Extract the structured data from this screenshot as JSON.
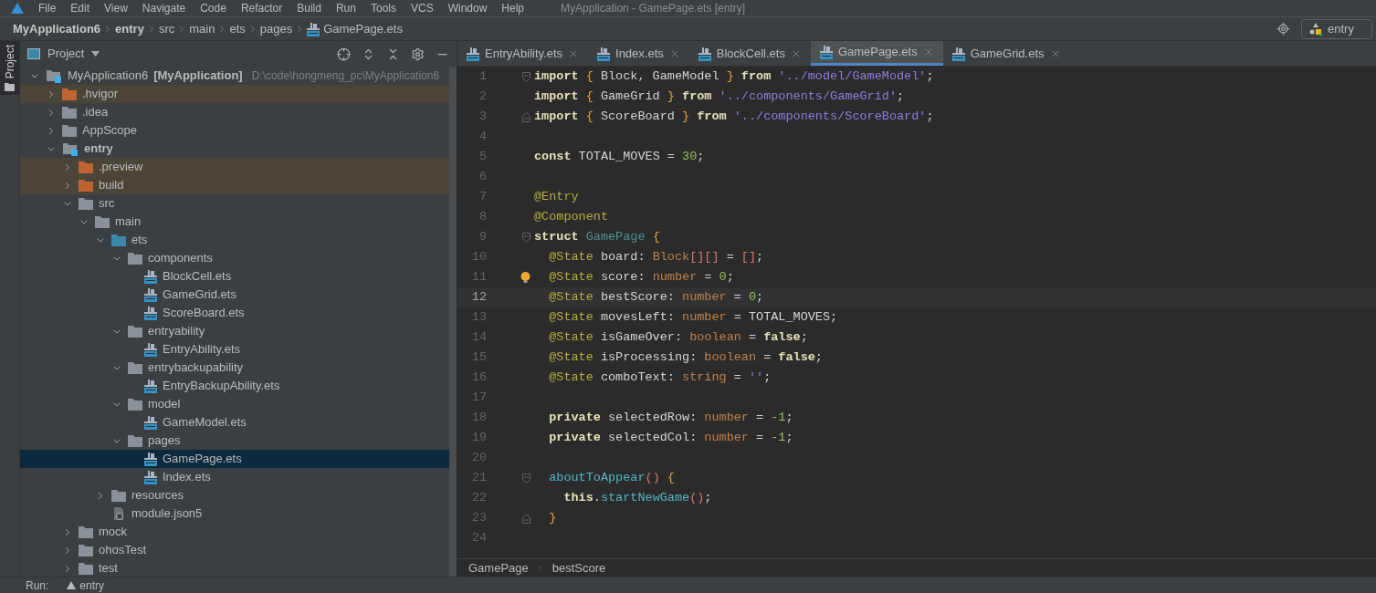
{
  "menu": {
    "items": [
      "File",
      "Edit",
      "View",
      "Navigate",
      "Code",
      "Refactor",
      "Build",
      "Run",
      "Tools",
      "VCS",
      "Window",
      "Help"
    ],
    "title": "MyApplication - GamePage.ets [entry]"
  },
  "nav_bar": {
    "crumbs": [
      {
        "label": "MyApplication6",
        "bold": true,
        "kind": "plain"
      },
      {
        "label": "entry",
        "bold": true,
        "kind": "plain"
      },
      {
        "label": "src",
        "bold": false,
        "kind": "plain"
      },
      {
        "label": "main",
        "bold": false,
        "kind": "plain"
      },
      {
        "label": "ets",
        "bold": false,
        "kind": "plain"
      },
      {
        "label": "pages",
        "bold": false,
        "kind": "plain"
      },
      {
        "label": "GamePage.ets",
        "bold": false,
        "kind": "ets"
      }
    ],
    "run_config": "entry"
  },
  "side_strip": {
    "tab": "Project"
  },
  "project_panel": {
    "title": "Project",
    "root": {
      "name": "MyApplication6",
      "module": "[MyApplication]",
      "path": "D:\\code\\hongmeng_pc\\MyApplication6",
      "expanded": true
    },
    "tree": [
      {
        "name": ".hvigor",
        "kind": "excluded",
        "expanded": false,
        "selected": false
      },
      {
        "name": ".idea",
        "kind": "folder",
        "expanded": false,
        "selected": false
      },
      {
        "name": "AppScope",
        "kind": "folder",
        "expanded": false,
        "selected": false
      },
      {
        "name": "entry",
        "kind": "module",
        "expanded": true,
        "selected": false,
        "children": [
          {
            "name": ".preview",
            "kind": "excluded",
            "expanded": false,
            "selected": false
          },
          {
            "name": "build",
            "kind": "excluded",
            "expanded": false,
            "selected": false
          },
          {
            "name": "src",
            "kind": "folder",
            "expanded": true,
            "selected": false,
            "children": [
              {
                "name": "main",
                "kind": "folder",
                "expanded": true,
                "selected": false,
                "children": [
                  {
                    "name": "ets",
                    "kind": "source",
                    "expanded": true,
                    "selected": false,
                    "children": [
                      {
                        "name": "components",
                        "kind": "folder",
                        "expanded": true,
                        "selected": false,
                        "children": [
                          {
                            "name": "BlockCell.ets",
                            "kind": "ets",
                            "selected": false
                          },
                          {
                            "name": "GameGrid.ets",
                            "kind": "ets",
                            "selected": false
                          },
                          {
                            "name": "ScoreBoard.ets",
                            "kind": "ets",
                            "selected": false
                          }
                        ]
                      },
                      {
                        "name": "entryability",
                        "kind": "folder",
                        "expanded": true,
                        "selected": false,
                        "children": [
                          {
                            "name": "EntryAbility.ets",
                            "kind": "ets",
                            "selected": false
                          }
                        ]
                      },
                      {
                        "name": "entrybackupability",
                        "kind": "folder",
                        "expanded": true,
                        "selected": false,
                        "children": [
                          {
                            "name": "EntryBackupAbility.ets",
                            "kind": "ets",
                            "selected": false
                          }
                        ]
                      },
                      {
                        "name": "model",
                        "kind": "folder",
                        "expanded": true,
                        "selected": false,
                        "children": [
                          {
                            "name": "GameModel.ets",
                            "kind": "ets",
                            "selected": false
                          }
                        ]
                      },
                      {
                        "name": "pages",
                        "kind": "folder",
                        "expanded": true,
                        "selected": false,
                        "children": [
                          {
                            "name": "GamePage.ets",
                            "kind": "ets",
                            "selected": true
                          },
                          {
                            "name": "Index.ets",
                            "kind": "ets",
                            "selected": false
                          }
                        ]
                      }
                    ]
                  },
                  {
                    "name": "resources",
                    "kind": "folder",
                    "expanded": false,
                    "selected": false
                  },
                  {
                    "name": "module.json5",
                    "kind": "json",
                    "selected": false
                  }
                ]
              }
            ]
          },
          {
            "name": "mock",
            "kind": "folder",
            "expanded": false,
            "selected": false
          },
          {
            "name": "ohosTest",
            "kind": "folder",
            "expanded": false,
            "selected": false
          },
          {
            "name": "test",
            "kind": "folder",
            "expanded": false,
            "selected": false
          }
        ]
      }
    ]
  },
  "tabs": [
    {
      "label": "EntryAbility.ets",
      "selected": false
    },
    {
      "label": "Index.ets",
      "selected": false
    },
    {
      "label": "BlockCell.ets",
      "selected": false
    },
    {
      "label": "GamePage.ets",
      "selected": true
    },
    {
      "label": "GameGrid.ets",
      "selected": false
    }
  ],
  "editor": {
    "lines": [
      {
        "number": "1",
        "current": false,
        "gutter": [
          {
            "kind": "fold_open"
          }
        ],
        "tokens": [
          {
            "kind": "kw",
            "text": "import"
          },
          {
            "kind": "br",
            "text": " {"
          },
          {
            "kind": "id",
            "text": " Block, GameModel"
          },
          {
            "kind": "br",
            "text": " }"
          },
          {
            "kind": "kw",
            "text": " from"
          },
          {
            "kind": "str",
            "text": " '../model/GameModel'"
          },
          {
            "kind": "id",
            "text": ";"
          }
        ]
      },
      {
        "number": "2",
        "current": false,
        "tokens": [
          {
            "kind": "kw",
            "text": "import"
          },
          {
            "kind": "br",
            "text": " {"
          },
          {
            "kind": "id",
            "text": " GameGrid"
          },
          {
            "kind": "br",
            "text": " }"
          },
          {
            "kind": "kw",
            "text": " from"
          },
          {
            "kind": "str",
            "text": " '../components/GameGrid'"
          },
          {
            "kind": "id",
            "text": ";"
          }
        ]
      },
      {
        "number": "3",
        "current": false,
        "gutter": [
          {
            "kind": "fold_close"
          }
        ],
        "tokens": [
          {
            "kind": "kw",
            "text": "import"
          },
          {
            "kind": "br",
            "text": " {"
          },
          {
            "kind": "id",
            "text": " ScoreBoard"
          },
          {
            "kind": "br",
            "text": " }"
          },
          {
            "kind": "kw",
            "text": " from"
          },
          {
            "kind": "str",
            "text": " '../components/ScoreBoard'"
          },
          {
            "kind": "id",
            "text": ";"
          }
        ]
      },
      {
        "number": "4",
        "current": false
      },
      {
        "number": "5",
        "current": false,
        "tokens": [
          {
            "kind": "kw",
            "text": "const"
          },
          {
            "kind": "id",
            "text": " TOTAL_MOVES ="
          },
          {
            "kind": "num",
            "text": " 30"
          },
          {
            "kind": "id",
            "text": ";"
          }
        ]
      },
      {
        "number": "6",
        "current": false
      },
      {
        "number": "7",
        "current": false,
        "tokens": [
          {
            "kind": "dec",
            "text": "@Entry"
          }
        ]
      },
      {
        "number": "8",
        "current": false,
        "tokens": [
          {
            "kind": "dec",
            "text": "@Component"
          }
        ]
      },
      {
        "number": "9",
        "current": false,
        "gutter": [
          {
            "kind": "fold_open"
          }
        ],
        "tokens": [
          {
            "kind": "kw",
            "text": "struct"
          },
          {
            "kind": "cls",
            "text": " GamePage"
          },
          {
            "kind": "br",
            "text": " {"
          }
        ]
      },
      {
        "number": "10",
        "current": false,
        "tokens": [
          {
            "kind": "dec",
            "text": "  @State"
          },
          {
            "kind": "id",
            "text": " board:"
          },
          {
            "kind": "type",
            "text": " Block"
          },
          {
            "kind": "paren",
            "text": "[][]"
          },
          {
            "kind": "id",
            "text": " ="
          },
          {
            "kind": "paren",
            "text": " []"
          },
          {
            "kind": "id",
            "text": ";"
          }
        ]
      },
      {
        "number": "11",
        "current": false,
        "gutter": [
          {
            "kind": "bulb"
          }
        ],
        "tokens": [
          {
            "kind": "dec",
            "text": "  @State"
          },
          {
            "kind": "id",
            "text": " score:"
          },
          {
            "kind": "type",
            "text": " number"
          },
          {
            "kind": "id",
            "text": " ="
          },
          {
            "kind": "num",
            "text": " 0"
          },
          {
            "kind": "id",
            "text": ";"
          }
        ]
      },
      {
        "number": "12",
        "current": true,
        "tokens": [
          {
            "kind": "dec",
            "text": "  @State"
          },
          {
            "kind": "id",
            "text": " bestScore:"
          },
          {
            "kind": "type",
            "text": " number"
          },
          {
            "kind": "id",
            "text": " ="
          },
          {
            "kind": "num",
            "text": " 0"
          },
          {
            "kind": "id",
            "text": ";"
          }
        ]
      },
      {
        "number": "13",
        "current": false,
        "tokens": [
          {
            "kind": "dec",
            "text": "  @State"
          },
          {
            "kind": "id",
            "text": " movesLeft:"
          },
          {
            "kind": "type",
            "text": " number"
          },
          {
            "kind": "id",
            "text": " = TOTAL_MOVES;"
          }
        ]
      },
      {
        "number": "14",
        "current": false,
        "tokens": [
          {
            "kind": "dec",
            "text": "  @State"
          },
          {
            "kind": "id",
            "text": " isGameOver:"
          },
          {
            "kind": "type",
            "text": " boolean"
          },
          {
            "kind": "id",
            "text": " ="
          },
          {
            "kind": "kw",
            "text": " false"
          },
          {
            "kind": "id",
            "text": ";"
          }
        ]
      },
      {
        "number": "15",
        "current": false,
        "tokens": [
          {
            "kind": "dec",
            "text": "  @State"
          },
          {
            "kind": "id",
            "text": " isProcessing:"
          },
          {
            "kind": "type",
            "text": " boolean"
          },
          {
            "kind": "id",
            "text": " ="
          },
          {
            "kind": "kw",
            "text": " false"
          },
          {
            "kind": "id",
            "text": ";"
          }
        ]
      },
      {
        "number": "16",
        "current": false,
        "tokens": [
          {
            "kind": "dec",
            "text": "  @State"
          },
          {
            "kind": "id",
            "text": " comboText:"
          },
          {
            "kind": "type",
            "text": " string"
          },
          {
            "kind": "id",
            "text": " ="
          },
          {
            "kind": "str",
            "text": " ''"
          },
          {
            "kind": "id",
            "text": ";"
          }
        ]
      },
      {
        "number": "17",
        "current": false
      },
      {
        "number": "18",
        "current": false,
        "tokens": [
          {
            "kind": "kw",
            "text": "  private"
          },
          {
            "kind": "id",
            "text": " selectedRow:"
          },
          {
            "kind": "type",
            "text": " number"
          },
          {
            "kind": "id",
            "text": " ="
          },
          {
            "kind": "num",
            "text": " -1"
          },
          {
            "kind": "id",
            "text": ";"
          }
        ]
      },
      {
        "number": "19",
        "current": false,
        "tokens": [
          {
            "kind": "kw",
            "text": "  private"
          },
          {
            "kind": "id",
            "text": " selectedCol:"
          },
          {
            "kind": "type",
            "text": " number"
          },
          {
            "kind": "id",
            "text": " ="
          },
          {
            "kind": "num",
            "text": " -1"
          },
          {
            "kind": "id",
            "text": ";"
          }
        ]
      },
      {
        "number": "20",
        "current": false
      },
      {
        "number": "21",
        "current": false,
        "gutter": [
          {
            "kind": "fold_open"
          }
        ],
        "tokens": [
          {
            "kind": "fn",
            "text": "  aboutToAppear"
          },
          {
            "kind": "paren",
            "text": "()"
          },
          {
            "kind": "br",
            "text": " {"
          }
        ]
      },
      {
        "number": "22",
        "current": false,
        "tokens": [
          {
            "kind": "kw",
            "text": "    this"
          },
          {
            "kind": "id",
            "text": "."
          },
          {
            "kind": "fn",
            "text": "startNewGame"
          },
          {
            "kind": "paren",
            "text": "()"
          },
          {
            "kind": "id",
            "text": ";"
          }
        ]
      },
      {
        "number": "23",
        "current": false,
        "gutter": [
          {
            "kind": "fold_close"
          }
        ],
        "tokens": [
          {
            "kind": "br",
            "text": "  }"
          }
        ]
      },
      {
        "number": "24",
        "current": false
      }
    ]
  },
  "editor_breadcrumb": [
    "GamePage",
    "bestScore"
  ],
  "bottom_bar": {
    "label": "Run:",
    "config": "entry"
  }
}
